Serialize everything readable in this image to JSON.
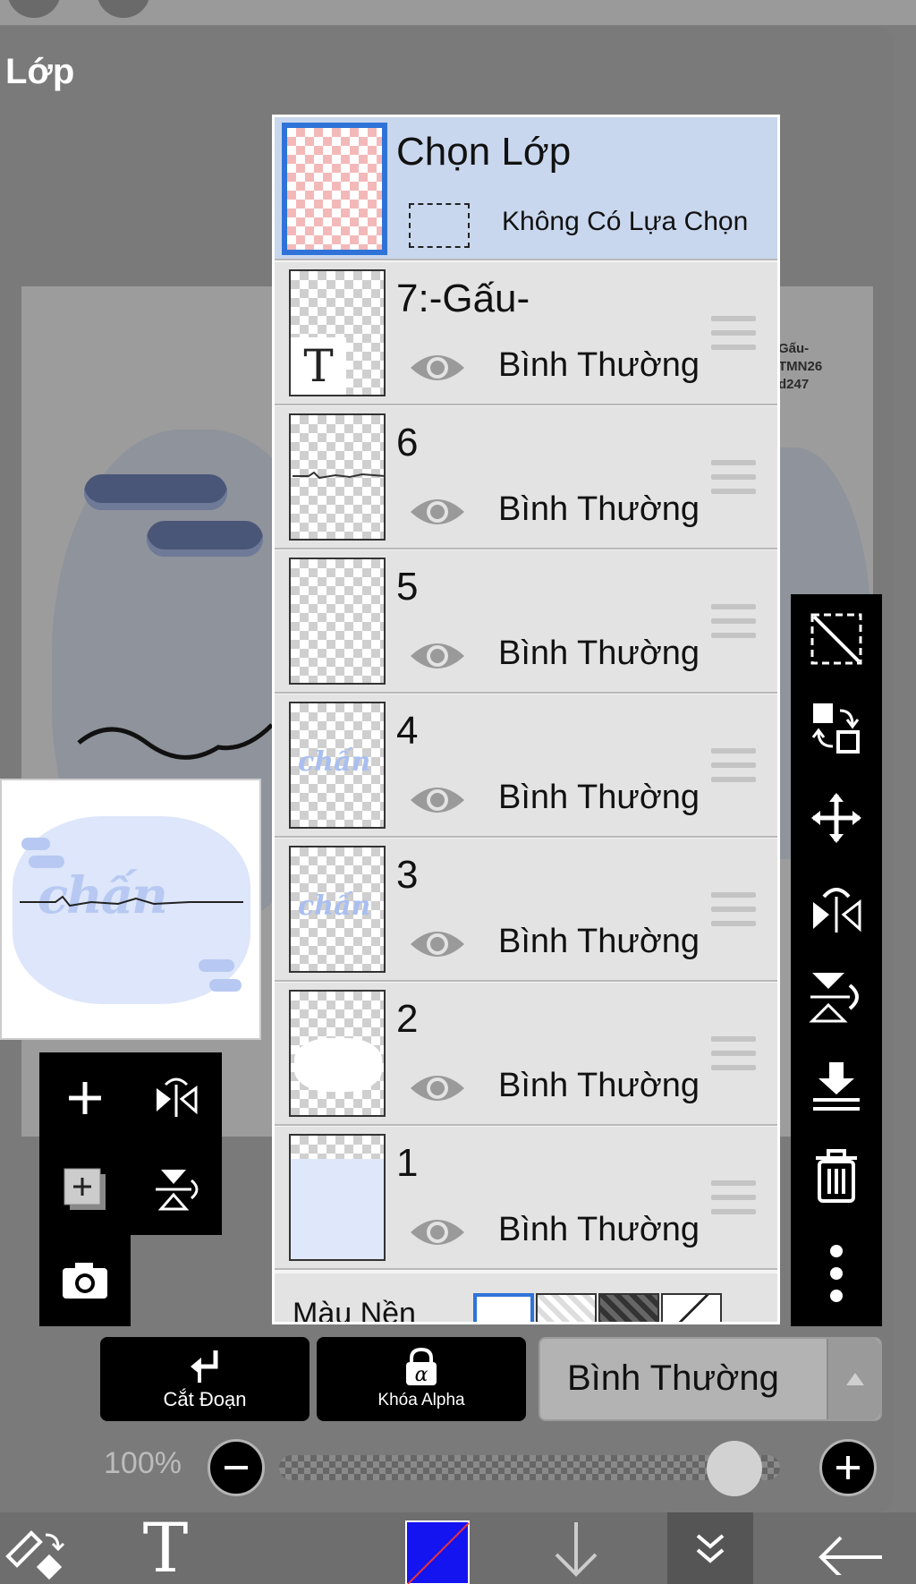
{
  "panel": {
    "title": "Lớp"
  },
  "canvas_text": [
    "Gấu-",
    "TMN26",
    "d247"
  ],
  "preview": {
    "word": "chấn"
  },
  "selection_layer": {
    "title": "Chọn Lớp",
    "subtitle": "Không Có Lựa Chọn"
  },
  "layers": [
    {
      "name": "7:-Gấu-",
      "blend": "Bình Thường",
      "thumb": "text"
    },
    {
      "name": "6",
      "blend": "Bình Thường",
      "thumb": "line"
    },
    {
      "name": "5",
      "blend": "Bình Thường",
      "thumb": "empty"
    },
    {
      "name": "4",
      "blend": "Bình Thường",
      "thumb": "word"
    },
    {
      "name": "3",
      "blend": "Bình Thường",
      "thumb": "word"
    },
    {
      "name": "2",
      "blend": "Bình Thường",
      "thumb": "white"
    },
    {
      "name": "1",
      "blend": "Bình Thường",
      "thumb": "blue"
    }
  ],
  "layer_text_thumb": "T",
  "layer_thumb_word": "chấn",
  "background": {
    "label": "Màu Nền"
  },
  "clipping": {
    "label": "Cắt Đoạn"
  },
  "alpha_lock": {
    "label": "Khóa Alpha",
    "glyph": "α"
  },
  "blend_mode": {
    "value": "Bình Thường"
  },
  "opacity": {
    "label": "100%",
    "value": 100
  },
  "bottom": {
    "text_tool": "T"
  },
  "colors": {
    "selected_blue": "#2f73d8",
    "selected_row": "#c9d7ee",
    "toolbar": "#000000",
    "brush_color": "#1414f0"
  }
}
